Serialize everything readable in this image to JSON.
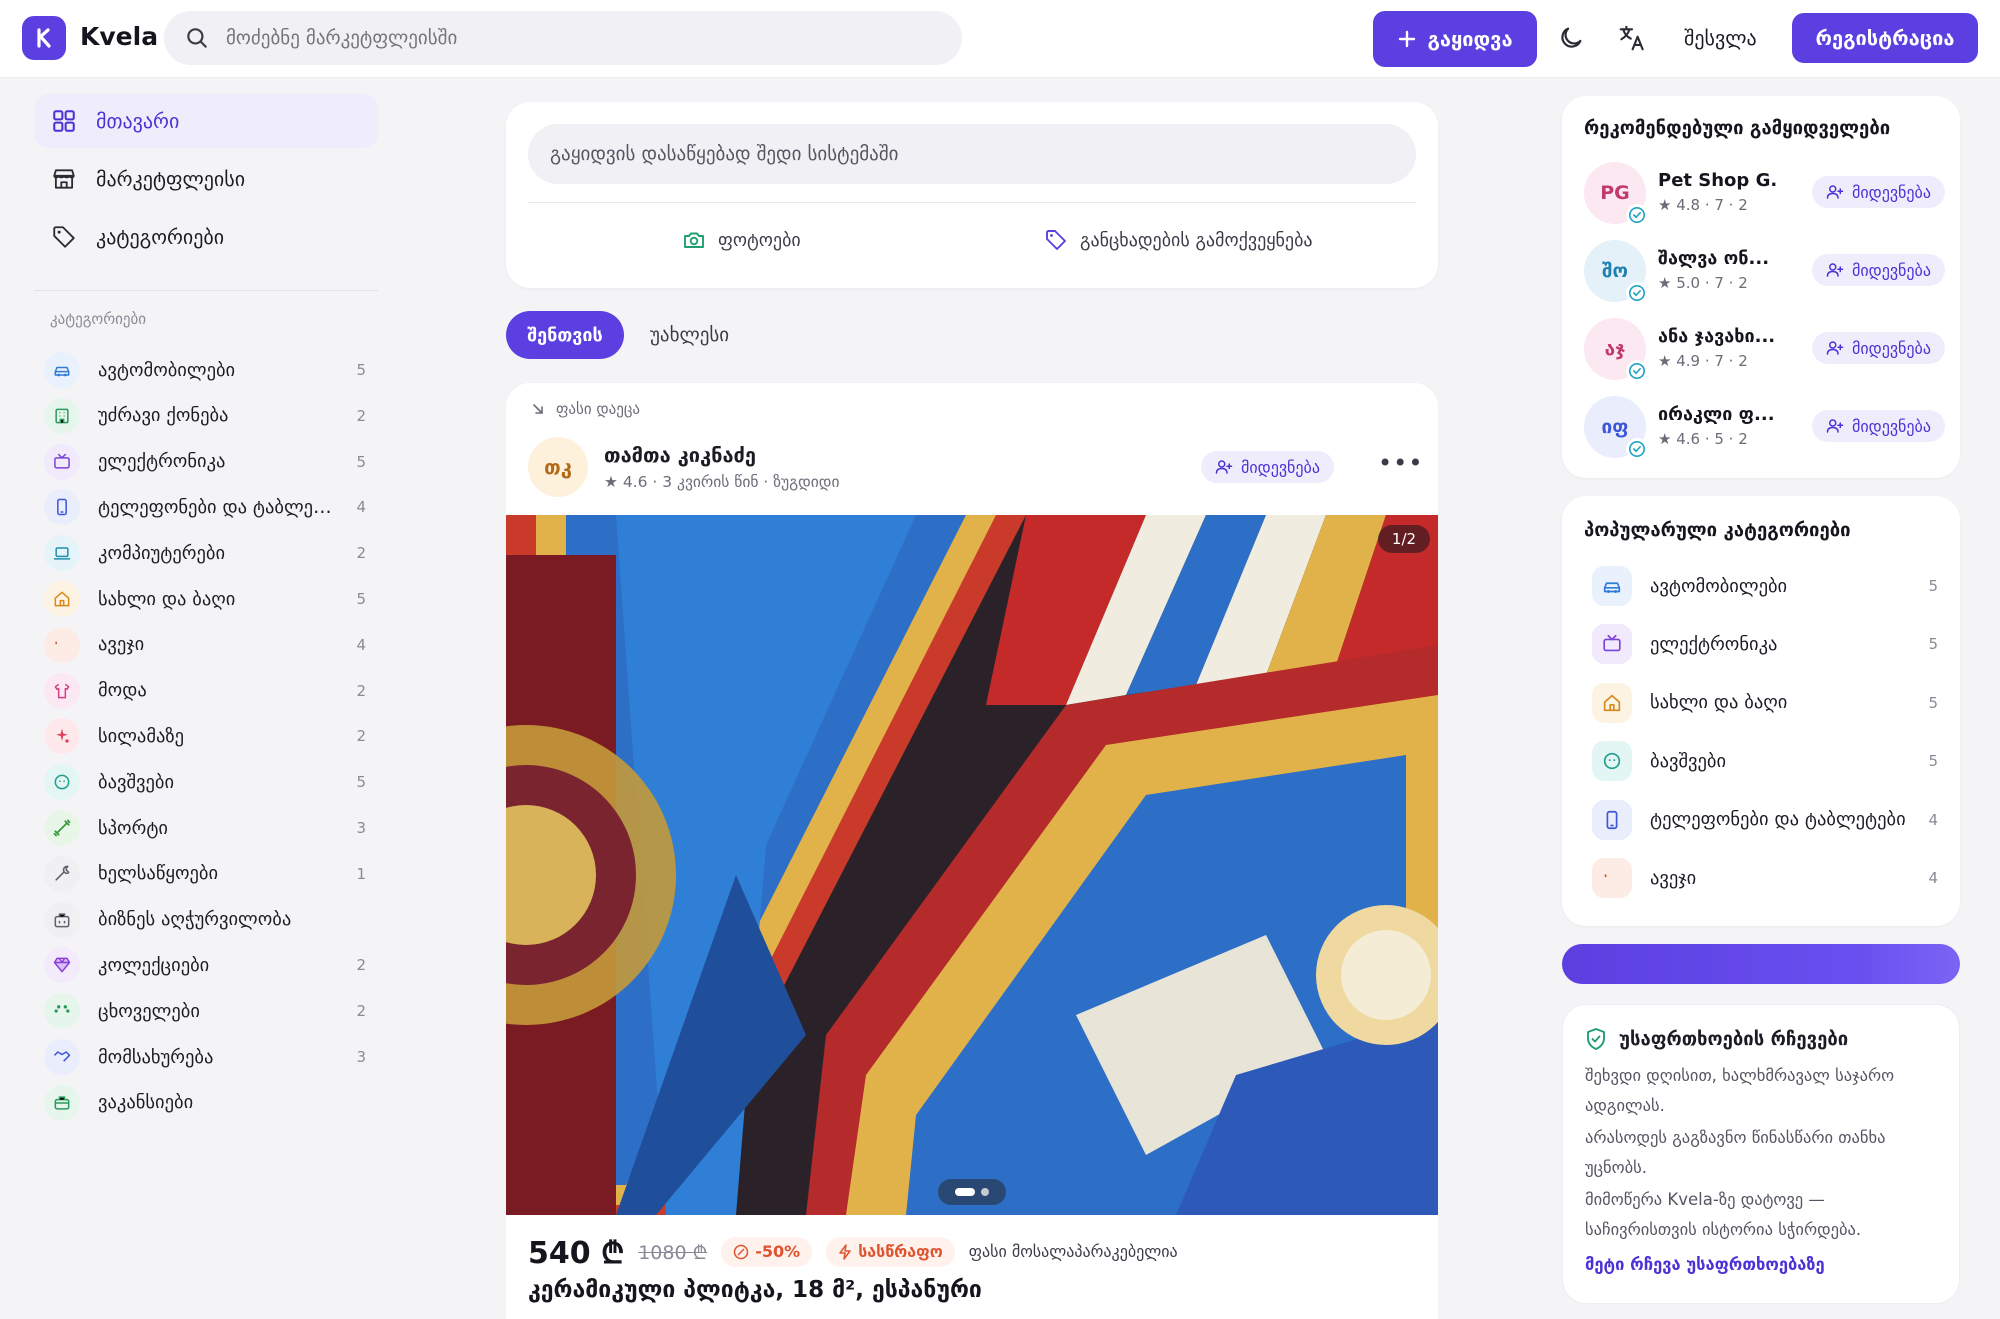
{
  "header": {
    "logo_letter": "K",
    "brand": "Kvela",
    "search_placeholder": "მოძებნე მარკეტფლეისში",
    "sell_label": "გაყიდვა",
    "login_label": "შესვლა",
    "register_label": "რეგისტრაცია"
  },
  "nav": {
    "items": [
      {
        "label": "მთავარი",
        "icon": "grid-icon",
        "active": true
      },
      {
        "label": "მარკეტფლეისი",
        "icon": "store-icon",
        "active": false
      },
      {
        "label": "კატეგორიები",
        "icon": "tag-icon",
        "active": false
      }
    ]
  },
  "categories": {
    "heading": "კატეგორიები",
    "items": [
      {
        "label": "ავტომობილები",
        "count": "5",
        "icon": "car-icon",
        "color": "#2f7bd9",
        "bg": "#e8f1fc"
      },
      {
        "label": "უძრავი ქონება",
        "count": "2",
        "icon": "building-icon",
        "color": "#2a9a5c",
        "bg": "#e6f6ec"
      },
      {
        "label": "ელექტრონიკა",
        "count": "5",
        "icon": "tv-icon",
        "color": "#7b43d6",
        "bg": "#f1eafc"
      },
      {
        "label": "ტელეფონები და ტაბლეტები",
        "count": "4",
        "icon": "phone-icon",
        "color": "#3b56d8",
        "bg": "#eaeefc"
      },
      {
        "label": "კომპიუტერები",
        "count": "2",
        "icon": "laptop-icon",
        "color": "#1f8fb0",
        "bg": "#e4f4f8"
      },
      {
        "label": "სახლი და ბაღი",
        "count": "5",
        "icon": "home-icon",
        "color": "#d68a1a",
        "bg": "#fdf3e2"
      },
      {
        "label": "ავეჯი",
        "count": "4",
        "icon": "sofa-icon",
        "color": "#d9542f",
        "bg": "#fdebe5"
      },
      {
        "label": "მოდა",
        "count": "2",
        "icon": "shirt-icon",
        "color": "#d43f87",
        "bg": "#fce8f2"
      },
      {
        "label": "სილამაზე",
        "count": "2",
        "icon": "sparkle-icon",
        "color": "#e0405a",
        "bg": "#fde8ec"
      },
      {
        "label": "ბავშვები",
        "count": "5",
        "icon": "baby-icon",
        "color": "#1f9f8f",
        "bg": "#e3f6f3"
      },
      {
        "label": "სპორტი",
        "count": "3",
        "icon": "dumbbell-icon",
        "color": "#3a9c3f",
        "bg": "#e8f6e8"
      },
      {
        "label": "ხელსაწყოები",
        "count": "1",
        "icon": "wrench-icon",
        "color": "#5f5f6b",
        "bg": "#f0f0f3"
      },
      {
        "label": "ბიზნეს აღჭურვილობა",
        "count": "",
        "icon": "briefcase-icon",
        "color": "#5f5f6b",
        "bg": "#f0f0f3"
      },
      {
        "label": "კოლექციები",
        "count": "2",
        "icon": "gem-icon",
        "color": "#8a3fd6",
        "bg": "#f3eafc"
      },
      {
        "label": "ცხოველები",
        "count": "2",
        "icon": "paw-icon",
        "color": "#2a9a5c",
        "bg": "#e6f6ec"
      },
      {
        "label": "მომსახურება",
        "count": "3",
        "icon": "handshake-icon",
        "color": "#3b56d8",
        "bg": "#eaeefc"
      },
      {
        "label": "ვაკანსიები",
        "count": "",
        "icon": "job-icon",
        "color": "#2a9a5c",
        "bg": "#e6f6ec"
      }
    ]
  },
  "composer": {
    "placeholder": "გაყიდვის დასაწყებად შედი სისტემაში",
    "photos_label": "ფოტოები",
    "publish_label": "განცხადების გამოქვეყნება"
  },
  "feed_tabs": {
    "active": "შენთვის",
    "other": "უახლესი"
  },
  "post": {
    "tag": "ფასი დაეცა",
    "author_initials": "თკ",
    "author_name": "თამთა კიკნაძე",
    "author_meta": "★ 4.6 · 3 კვირის წინ · ზუგდიდი",
    "follow_label": "მიდევნება",
    "image_counter": "1/2",
    "price": "540 ₾",
    "old_price": "1080 ₾",
    "discount": "-50%",
    "urgent": "სასწრაფო",
    "negotiable": "ფასი მოსალაპარაკებელია",
    "title": "კერამიკული პლიტკა, 18 მ², ესპანური"
  },
  "recommended": {
    "title": "რეკომენდებული გამყიდველები",
    "follow_label": "მიდევნება",
    "sellers": [
      {
        "initials": "PG",
        "name": "Pet Shop G...",
        "rating": "★ 4.8 · 7 · 2",
        "color": "#c23a6c",
        "bg": "#fce8f0"
      },
      {
        "initials": "შო",
        "name": "შალვა ონ...",
        "rating": "★ 5.0 · 7 · 2",
        "color": "#1f7fb0",
        "bg": "#e4f1f8"
      },
      {
        "initials": "აჯ",
        "name": "ანა ჯავახი...",
        "rating": "★ 4.9 · 7 · 2",
        "color": "#c23a6c",
        "bg": "#fce8f0"
      },
      {
        "initials": "იფ",
        "name": "ირაკლი ფ...",
        "rating": "★ 4.6 · 5 · 2",
        "color": "#3b56d8",
        "bg": "#eaeefc"
      }
    ]
  },
  "popular": {
    "title": "პოპულარული კატეგორიები",
    "items": [
      {
        "label": "ავტომობილები",
        "count": "5",
        "icon": "car-icon",
        "color": "#2f7bd9",
        "bg": "#e8f1fc"
      },
      {
        "label": "ელექტრონიკა",
        "count": "5",
        "icon": "tv-icon",
        "color": "#7b43d6",
        "bg": "#f1eafc"
      },
      {
        "label": "სახლი და ბაღი",
        "count": "5",
        "icon": "home-icon",
        "color": "#d68a1a",
        "bg": "#fdf3e2"
      },
      {
        "label": "ბავშვები",
        "count": "5",
        "icon": "baby-icon",
        "color": "#1f9f8f",
        "bg": "#e3f6f3"
      },
      {
        "label": "ტელეფონები და ტაბლეტები",
        "count": "4",
        "icon": "phone-icon",
        "color": "#3b56d8",
        "bg": "#eaeefc"
      },
      {
        "label": "ავეჯი",
        "count": "4",
        "icon": "sofa-icon",
        "color": "#d9542f",
        "bg": "#fdebe5"
      }
    ]
  },
  "safety": {
    "title": "უსაფრთხოების რჩევები",
    "tips": [
      "შეხვდი დღისით, ხალხმრავალ საჯარო ადგილას.",
      "არასოდეს გაგზავნო წინასწარი თანხა უცნობს.",
      "მიმოწერა Kvela-ზე დატოვე — საჩივრისთვის ისტორია სჭირდება."
    ],
    "link": "მეტი რჩევა უსაფრთხოებაზე"
  },
  "colors": {
    "accent": "#5b3fe0",
    "accent_soft": "#efedfc",
    "urgent": "#e0532f"
  }
}
